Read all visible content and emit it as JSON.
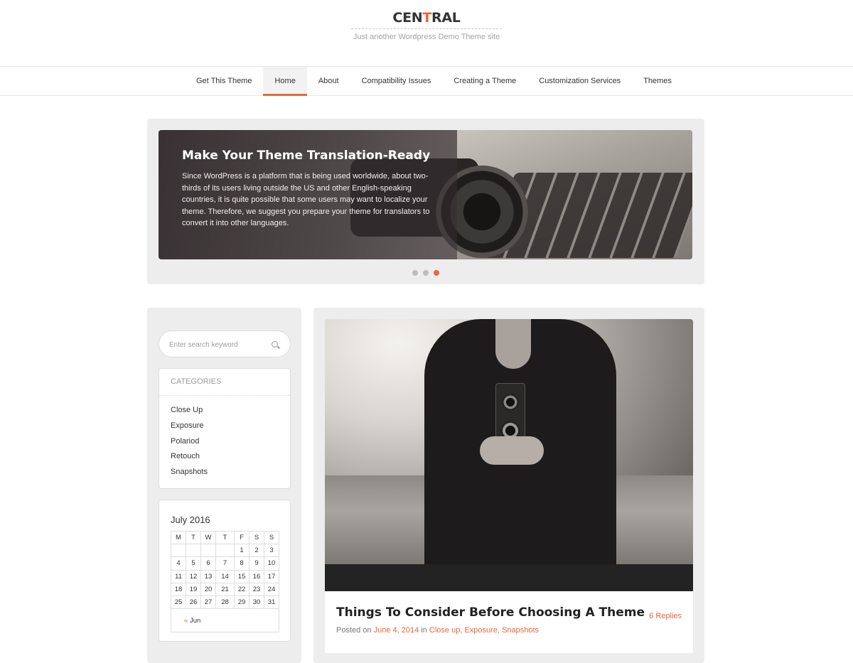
{
  "header": {
    "title_part1": "CEN",
    "title_accent": "T",
    "title_part2": "RAL",
    "tagline": "Just another Wordpress Demo Theme site"
  },
  "nav": {
    "items": [
      {
        "label": "Get This Theme"
      },
      {
        "label": "Home",
        "active": true
      },
      {
        "label": "About"
      },
      {
        "label": "Compatibility Issues"
      },
      {
        "label": "Creating a Theme"
      },
      {
        "label": "Customization Services"
      },
      {
        "label": "Themes"
      }
    ]
  },
  "slider": {
    "title": "Make Your Theme Translation-Ready",
    "text": "Since WordPress is a platform that is being used worldwide, about two-thirds of its users living outside the US and other English-speaking countries, it is quite possible that some users may want to localize your theme. Therefore, we suggest you prepare your theme for translators to convert it into other languages.",
    "slide_count": 3,
    "active_slide": 3
  },
  "sidebar": {
    "search_placeholder": "Enter search keyword",
    "categories_title": "CATEGORIES",
    "categories": [
      "Close Up",
      "Exposure",
      "Polariod",
      "Retouch",
      "Snapshots"
    ],
    "calendar": {
      "caption": "July 2016",
      "weekdays": [
        "M",
        "T",
        "W",
        "T",
        "F",
        "S",
        "S"
      ],
      "weeks": [
        [
          "",
          "",
          "",
          "",
          "1",
          "2",
          "3"
        ],
        [
          "4",
          "5",
          "6",
          "7",
          "8",
          "9",
          "10"
        ],
        [
          "11",
          "12",
          "13",
          "14",
          "15",
          "16",
          "17"
        ],
        [
          "18",
          "19",
          "20",
          "21",
          "22",
          "23",
          "24"
        ],
        [
          "25",
          "26",
          "27",
          "28",
          "29",
          "30",
          "31"
        ]
      ],
      "prev_arrow": "«",
      "prev_label": "Jun"
    }
  },
  "post": {
    "title": "Things To Consider Before Choosing A Theme",
    "replies": "6 Replies",
    "posted_on": "Posted on",
    "date": "June 4, 2014",
    "in": "in",
    "cat1": "Close up",
    "sep1": ",",
    "cat2": "Exposure",
    "sep2": ",",
    "cat3": "Snapshots"
  },
  "colors": {
    "accent": "#e8673c",
    "panel": "#ededed"
  }
}
